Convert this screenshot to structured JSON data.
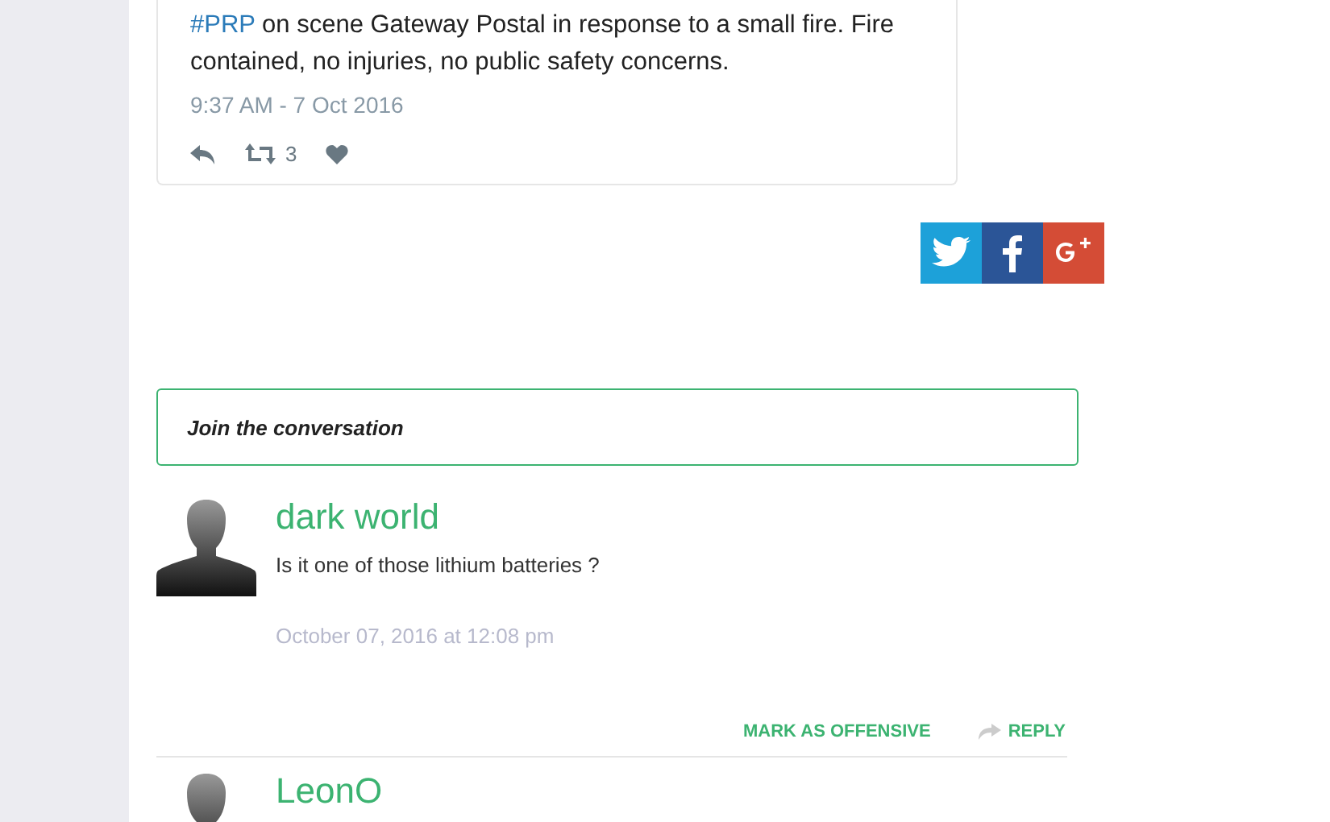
{
  "tweet": {
    "hashtag": "#PRP",
    "text": " on scene Gateway Postal in response to a small fire. Fire contained, no injuries, no public safety concerns.",
    "time": "9:37 AM - 7 Oct 2016",
    "retweets": "3"
  },
  "share": [
    {
      "kind": "twitter"
    },
    {
      "kind": "facebook"
    },
    {
      "kind": "googleplus"
    }
  ],
  "join_prompt": "Join the conversation",
  "comments": [
    {
      "author": "dark world",
      "text": "Is it one of those lithium batteries ?",
      "date": "October 07, 2016 at 12:08 pm",
      "actions": [
        "MARK AS OFFENSIVE",
        "REPLY"
      ]
    },
    {
      "author": "LeonO"
    }
  ]
}
